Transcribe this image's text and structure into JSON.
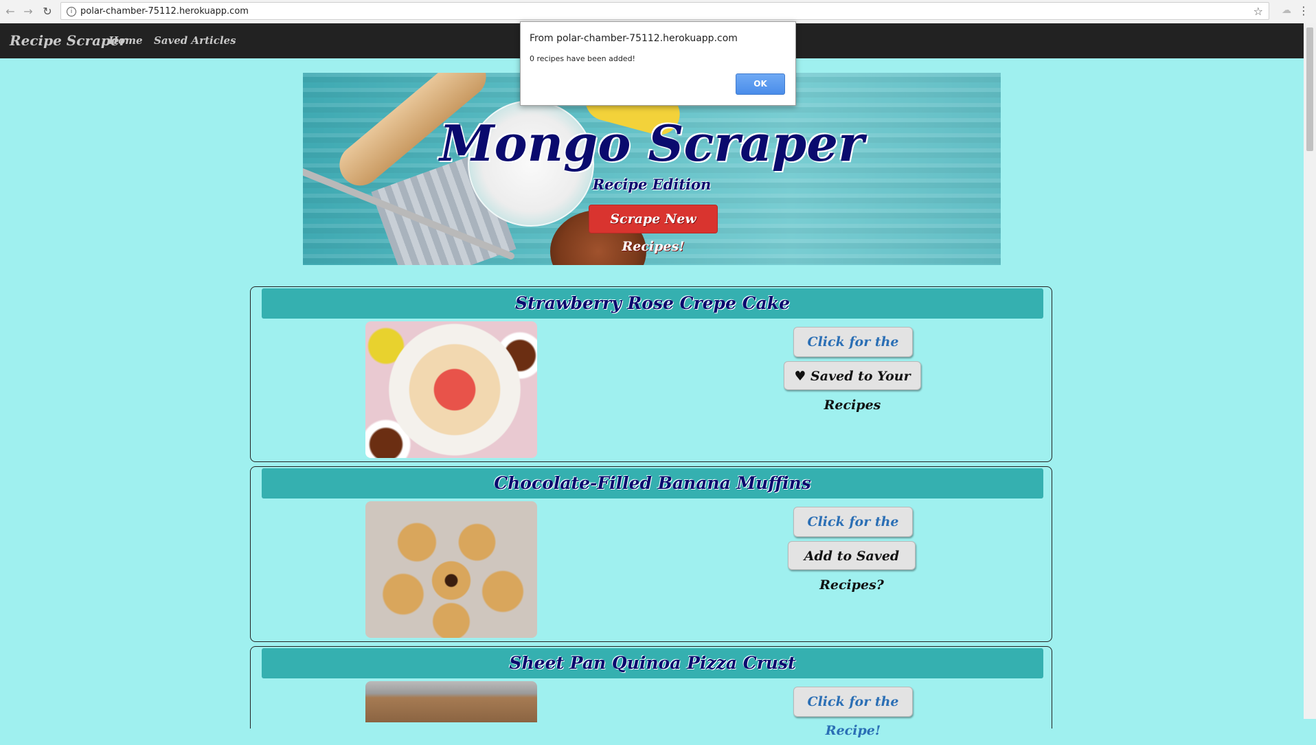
{
  "browser": {
    "url": "polar-chamber-75112.herokuapp.com",
    "icons": {
      "back": "back-arrow-icon",
      "forward": "forward-arrow-icon",
      "reload": "reload-icon",
      "info": "info-icon",
      "star": "star-icon",
      "menu": "menu-icon"
    }
  },
  "navbar": {
    "brand": "Recipe Scraper",
    "links": [
      "Home",
      "Saved Articles"
    ]
  },
  "hero": {
    "title": "Mongo Scraper",
    "subtitle": "Recipe Edition",
    "scrape_button": "Scrape New Recipes!"
  },
  "articles": [
    {
      "title": "Strawberry Rose Crepe Cake",
      "recipe_button": "Click for the Recipe!",
      "save_button": "♥ Saved to Your Recipes",
      "saved": true
    },
    {
      "title": "Chocolate-Filled Banana Muffins",
      "recipe_button": "Click for the Recipe!",
      "save_button": "Add to Saved Recipes?",
      "saved": false
    },
    {
      "title": "Sheet Pan Quinoa Pizza Crust",
      "recipe_button": "Click for the Recipe!"
    }
  ],
  "alert": {
    "title": "From polar-chamber-75112.herokuapp.com",
    "message": "0 recipes have been added!",
    "ok_button": "OK"
  },
  "colors": {
    "page_background": "#9FF0EF",
    "navbar": "#222222",
    "card_header": "#35B0B0",
    "title_text": "#0A0A6E",
    "scrape_button": "#D9342F",
    "recipe_link_text": "#2B6FB5",
    "ok_button": "#4A8DEA"
  }
}
